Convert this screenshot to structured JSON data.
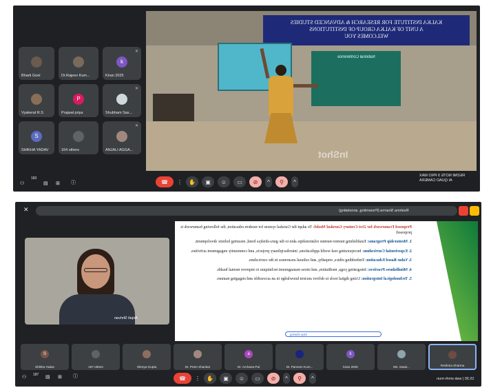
{
  "top_meeting": {
    "participants": [
      {
        "label": "Bharti Goel",
        "initial": ""
      },
      {
        "label": "Dr.Rajeev Kum...",
        "initial": ""
      },
      {
        "label": "Kiran 2025",
        "initial": "k"
      },
      {
        "label": "Vyakeral R.S",
        "initial": ""
      },
      {
        "label": "Prajwal priya",
        "initial": "P"
      },
      {
        "label": "Shubham Sax...",
        "initial": ""
      },
      {
        "label": "SHIKHA YADAV",
        "initial": "S"
      },
      {
        "label": "164 others",
        "initial": ""
      },
      {
        "label": "ANJALI AGGA...",
        "initial": ""
      }
    ],
    "banner_lines": [
      "KALKA INSTITUTE FOR RESEARCH & ADVANCED STUDIES",
      "A UNIT OF KALKA GROUP OF INSTITUTIONS",
      "WELCOMES YOU"
    ],
    "board_text": "National Conference",
    "watermark": "InShot",
    "camera_tag_line1": "REDMI NOTE 9 PRO MAX",
    "camera_tag_line2": "AI QUAD CAMERA",
    "bar_badge": "183",
    "colors": {
      "red": "#ea4335",
      "accent": "#8ab4f8"
    }
  },
  "bottom_meeting": {
    "presenting_label": "Reshma Sharma (Presenting, annotating)",
    "self_name": "Anjali Shrivan",
    "slide_items": [
      {
        "heading": "Proposed Framework for 21st-Century Gurukul Model:",
        "text": "To adapt the Gurukul system for modern education, the following framework is proposed:"
      },
      {
        "heading": "1. Mentorship Programs:",
        "text": "Establishing mentor-mentee relationships akin to the guru-shishya bond, ensuring holistic development."
      },
      {
        "heading": "2. Experiential Curriculum:",
        "text": "Incorporating real-world applications, interdisciplinary projects, and community engagement activities."
      },
      {
        "heading": "3. Value-Based Education:",
        "text": "Embedding ethics, empathy, and cultural awareness in the curriculum."
      },
      {
        "heading": "4. Mindfulness Practices:",
        "text": "Integrating yoga, meditation, and stress-management techniques to improve mental health."
      },
      {
        "heading": "5. Technological Integration:",
        "text": "Using digital tools to deliver ancient knowledge in an accessible and engaging manner."
      }
    ],
    "slide_footer": "Stop sharing",
    "strip": [
      {
        "label": "Shikha Yadav",
        "initial": "S"
      },
      {
        "label": "187 others",
        "initial": ""
      },
      {
        "label": "Shreya Gupta",
        "initial": ""
      },
      {
        "label": "Dr. Prem Shankar",
        "initial": ""
      },
      {
        "label": "Dr. Archana Pal",
        "initial": "a"
      },
      {
        "label": "Dr. Parveen Kum...",
        "initial": ""
      },
      {
        "label": "kiran 2025",
        "initial": "k"
      },
      {
        "label": "Ms. Swati...",
        "initial": ""
      },
      {
        "label": "Reshma Sharma",
        "initial": ""
      }
    ],
    "meeting_code": "15:30 | wak-smrh-mun",
    "bar_badge": "187"
  }
}
